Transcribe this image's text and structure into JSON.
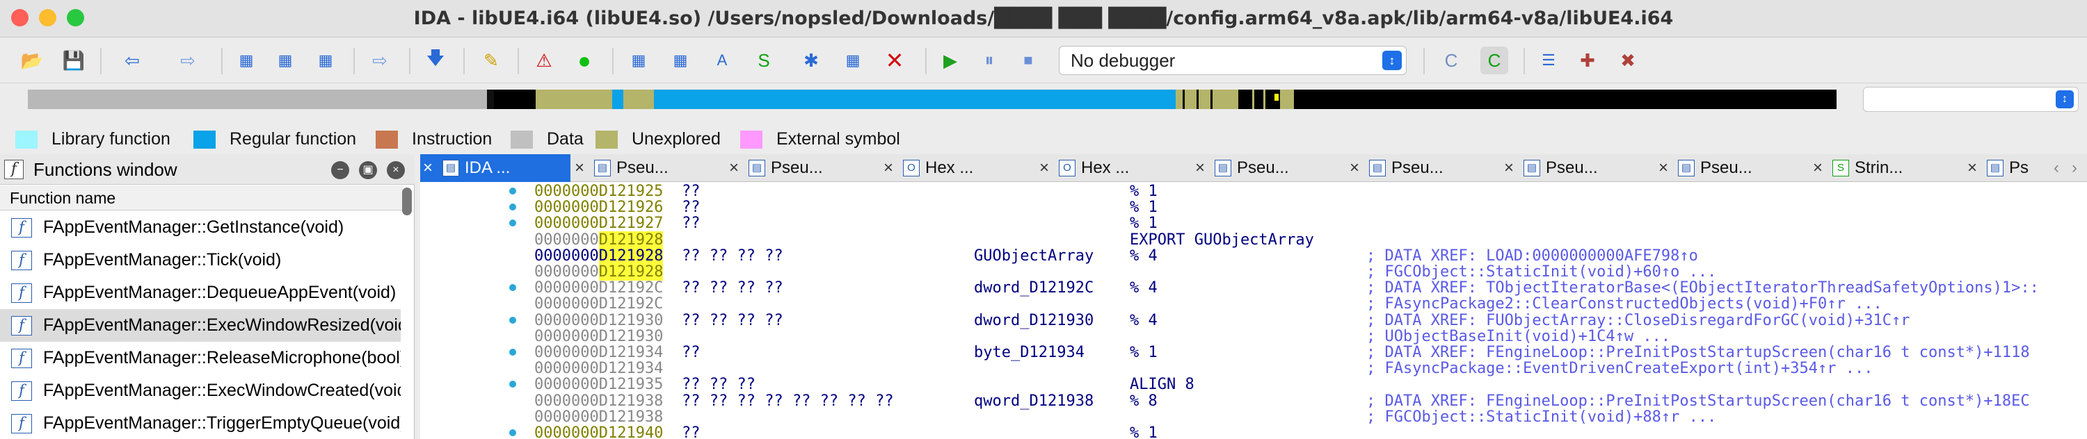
{
  "window": {
    "title": "IDA - libUE4.i64 (libUE4.so) /Users/nopsled/Downloads/████ ███ ████/config.arm64_v8a.apk/lib/arm64-v8a/libUE4.i64"
  },
  "colors": {
    "close": "#fe5f57",
    "minimize": "#febc2e",
    "zoom": "#28c840",
    "library_function": "#9cf5ff",
    "regular_function": "#0aa2e8",
    "instruction": "#c87850",
    "data": "#c0c0c0",
    "unexplored": "#b4b46a",
    "external_symbol": "#ff99ff",
    "accent": "#1f6fe0"
  },
  "toolbar": {
    "icons": [
      "open-folder-icon",
      "save-icon",
      "back-arrow-icon",
      "forward-arrow-icon",
      "jump-icon",
      "jump-name-icon",
      "jump-addr-icon",
      "text-search-icon",
      "down-arrow-icon",
      "lock-edit-icon",
      "warning-icon",
      "green-dot-icon",
      "add-seg-icon",
      "grid-icon",
      "text-icon",
      "struct-icon",
      "star-icon",
      "patch-icon",
      "delete-icon",
      "play-icon",
      "pause-icon",
      "stop-icon"
    ],
    "debugger": "No debugger",
    "right_icons": [
      "call-graph-icon",
      "code-graph-icon",
      "list-icon",
      "add-plugin-icon",
      "remove-plugin-icon"
    ]
  },
  "legend": [
    {
      "label": "Library function",
      "color": "#9cf5ff"
    },
    {
      "label": "Regular function",
      "color": "#0aa2e8"
    },
    {
      "label": "Instruction",
      "color": "#c87850"
    },
    {
      "label": "Data",
      "color": "#c0c0c0"
    },
    {
      "label": "Unexplored",
      "color": "#b4b46a"
    },
    {
      "label": "External symbol",
      "color": "#ff99ff"
    }
  ],
  "functions_window": {
    "title": "Functions window",
    "column": "Function name",
    "items": [
      "FAppEventManager::GetInstance(void)",
      "FAppEventManager::Tick(void)",
      "FAppEventManager::DequeueAppEvent(void)",
      "FAppEventManager::ExecWindowResized(void)",
      "FAppEventManager::ReleaseMicrophone(bool)",
      "FAppEventManager::ExecWindowCreated(void)",
      "FAppEventManager::TriggerEmptyQueue(void)"
    ],
    "selected": 3
  },
  "tabs": [
    {
      "label": "IDA ...",
      "icon": "ida-view-icon",
      "active": true
    },
    {
      "label": "Pseu...",
      "icon": "pseudocode-icon"
    },
    {
      "label": "Pseu...",
      "icon": "pseudocode-icon"
    },
    {
      "label": "Hex ...",
      "icon": "hex-view-icon"
    },
    {
      "label": "Hex ...",
      "icon": "hex-view-icon"
    },
    {
      "label": "Pseu...",
      "icon": "pseudocode-icon"
    },
    {
      "label": "Pseu...",
      "icon": "pseudocode-icon"
    },
    {
      "label": "Pseu...",
      "icon": "pseudocode-icon"
    },
    {
      "label": "Pseu...",
      "icon": "pseudocode-icon"
    },
    {
      "label": "Strin...",
      "icon": "strings-icon"
    },
    {
      "label": "Ps",
      "icon": "pseudocode-icon"
    }
  ],
  "listing": [
    {
      "dot": true,
      "a1": "0000000D121925",
      "bytes": "??",
      "name": "",
      "op": "% 1",
      "cm": ""
    },
    {
      "dot": true,
      "a1": "0000000D121926",
      "bytes": "??",
      "name": "",
      "op": "% 1",
      "cm": ""
    },
    {
      "dot": true,
      "a1": "0000000D121927",
      "bytes": "??",
      "name": "",
      "op": "% 1",
      "cm": ""
    },
    {
      "dot": false,
      "a1": "0000000",
      "hl": "D121928",
      "bytes": "",
      "name": "",
      "op": "EXPORT GUObjectArray",
      "cm": "",
      "grey": true
    },
    {
      "dot": false,
      "a1": "0000000",
      "hl": "D121928",
      "bytes": "?? ?? ?? ??",
      "name": "GUObjectArray",
      "op": "% 4",
      "cm": "; DATA XREF: LOAD:0000000000AFE798↑o",
      "blue": true
    },
    {
      "dot": false,
      "a1": "0000000",
      "hl": "D121928",
      "bytes": "",
      "name": "",
      "op": "",
      "cm": "; FGCObject::StaticInit(void)+60↑o ...",
      "grey": true
    },
    {
      "dot": true,
      "a1": "0000000D12192C",
      "bytes": "?? ?? ?? ??",
      "name": "dword_D12192C",
      "op": "% 4",
      "cm": "; DATA XREF: TObjectIteratorBase<(EObjectIteratorThreadSafetyOptions)1>::",
      "grey": true
    },
    {
      "dot": false,
      "a1": "0000000D12192C",
      "bytes": "",
      "name": "",
      "op": "",
      "cm": "; FAsyncPackage2::ClearConstructedObjects(void)+F0↑r ...",
      "grey": true
    },
    {
      "dot": true,
      "a1": "0000000D121930",
      "bytes": "?? ?? ?? ??",
      "name": "dword_D121930",
      "op": "% 4",
      "cm": "; DATA XREF: FUObjectArray::CloseDisregardForGC(void)+31C↑r",
      "grey": true
    },
    {
      "dot": false,
      "a1": "0000000D121930",
      "bytes": "",
      "name": "",
      "op": "",
      "cm": "; UObjectBaseInit(void)+1C4↑w ...",
      "grey": true
    },
    {
      "dot": true,
      "a1": "0000000D121934",
      "bytes": "??",
      "name": "byte_D121934",
      "op": "% 1",
      "cm": "; DATA XREF: FEngineLoop::PreInitPostStartupScreen(char16 t const*)+1118",
      "grey": true
    },
    {
      "dot": false,
      "a1": "0000000D121934",
      "bytes": "",
      "name": "",
      "op": "",
      "cm": "; FAsyncPackage::EventDrivenCreateExport(int)+354↑r ...",
      "grey": true
    },
    {
      "dot": true,
      "a1": "0000000D121935",
      "bytes": "?? ?? ??",
      "name": "",
      "op": "ALIGN 8",
      "cm": "",
      "grey": true
    },
    {
      "dot": false,
      "a1": "0000000D121938",
      "bytes": "?? ?? ?? ?? ?? ?? ?? ??",
      "name": "qword_D121938",
      "op": "% 8",
      "cm": "; DATA XREF: FEngineLoop::PreInitPostStartupScreen(char16 t const*)+18EC",
      "grey": true
    },
    {
      "dot": false,
      "a1": "0000000D121938",
      "bytes": "",
      "name": "",
      "op": "",
      "cm": "; FGCObject::StaticInit(void)+88↑r ...",
      "grey": true
    },
    {
      "dot": true,
      "a1": "0000000D121940",
      "bytes": "??",
      "name": "",
      "op": "% 1",
      "cm": ""
    }
  ]
}
